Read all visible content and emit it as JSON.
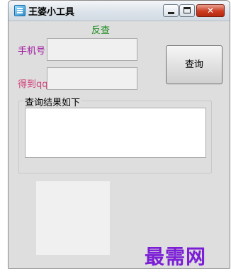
{
  "window": {
    "title": "王婆小工具",
    "controls": {
      "close_glyph": "✕"
    }
  },
  "form": {
    "heading": "反查",
    "phone_label": "手机号",
    "phone_value": "",
    "qq_label": "得到qq",
    "qq_value": "",
    "query_button": "查询"
  },
  "results": {
    "group_title": "查询结果如下",
    "text": ""
  },
  "watermark": "最需网",
  "colors": {
    "heading": "#1a8a1a",
    "phone_label": "#a01aa0",
    "qq_label": "#d0407a",
    "watermark": "#7b1ed6",
    "close_button": "#cc3b22"
  },
  "icons": [
    "app-icon",
    "minimize-icon",
    "maximize-icon",
    "close-icon"
  ]
}
